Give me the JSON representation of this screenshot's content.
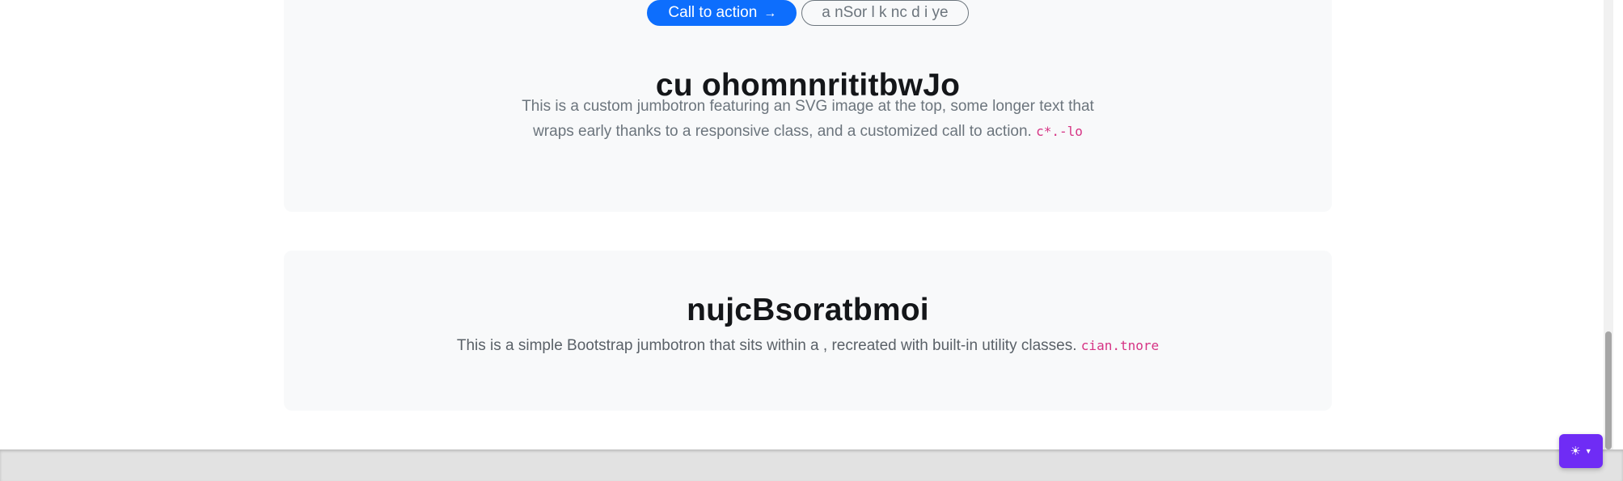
{
  "jumbotron_custom": {
    "primary_button_label": "Call to action",
    "primary_button_icon": "arrow-right-icon",
    "secondary_button_label": "a nSor l k nc d i ye",
    "title": "cu ohomnnrititbwJo",
    "lead_text": "This is a custom jumbotron featuring an SVG image at the top, some longer text that wraps early thanks to a responsive class, and a customized call to action.",
    "code_snippet": "c*.-lo"
  },
  "jumbotron_simple": {
    "title": "nujcBsoratbmoi",
    "lead_text": "This is a simple Bootstrap jumbotron that sits within a , recreated with built-in utility classes.",
    "code_snippet": "cian.tnore"
  },
  "theme_toggle": {
    "icon": "sun-icon",
    "caret_icon": "caret-down-icon",
    "accent_color": "#6f2cf5"
  },
  "colors": {
    "primary": "#0d6efd",
    "jumbotron_background": "#f8f9fa",
    "code": "#d63384"
  }
}
